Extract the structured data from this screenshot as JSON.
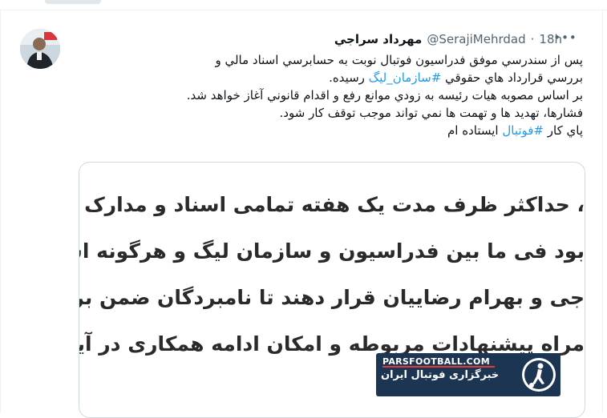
{
  "author": {
    "name": "مهرداد سراجي",
    "handle": "@SerajiMehrdad",
    "separator": "·",
    "time": "18h"
  },
  "more_icon": "more-horizontal-icon",
  "tweet": {
    "l1": "پس از سندرسي موفق فدراسيون فوتبال نوبت به حسابرسي اسناد مالي و",
    "l2a": "بررسي قرارداد هاي حقوقي ",
    "l2tag": "#سازمان_ليگ",
    "l2b": " رسيده.",
    "l3": "بر اساس مصوبه هيات رئيسه به زودي موانع رفع و اقدام قانوني آغاز خواهد شد.",
    "l4": "فشارها، تهديد ها و تهمت ها نمي تواند موجب توقف كار شود.",
    "l5a": "پاي كار ",
    "l5tag": "#فوتبال",
    "l5b": " ايستاده ام"
  },
  "media": {
    "lines": [
      "، حداكثر ظرف مدت یک هفته تمامی اسناد و مدارک ثبتی، اس",
      "بود فی ما بین فدراسیون و سازمان لیگ و هرگونه اسناد دیگ",
      "جی و بهرام رضاییان قرار دهند تا نامبردگان ضمن بررسی دق",
      "مراه پیشنهادات مربوطه و امکان ادامه همکاری در آینده به ه"
    ],
    "watermark_site": "PARSFOOTBALL.COM",
    "watermark_text": "خبرگزاری فوتبال ایران"
  },
  "colors": {
    "link": "#1d9bf0",
    "muted": "#536471",
    "watermark_bg": "#1b3553"
  }
}
